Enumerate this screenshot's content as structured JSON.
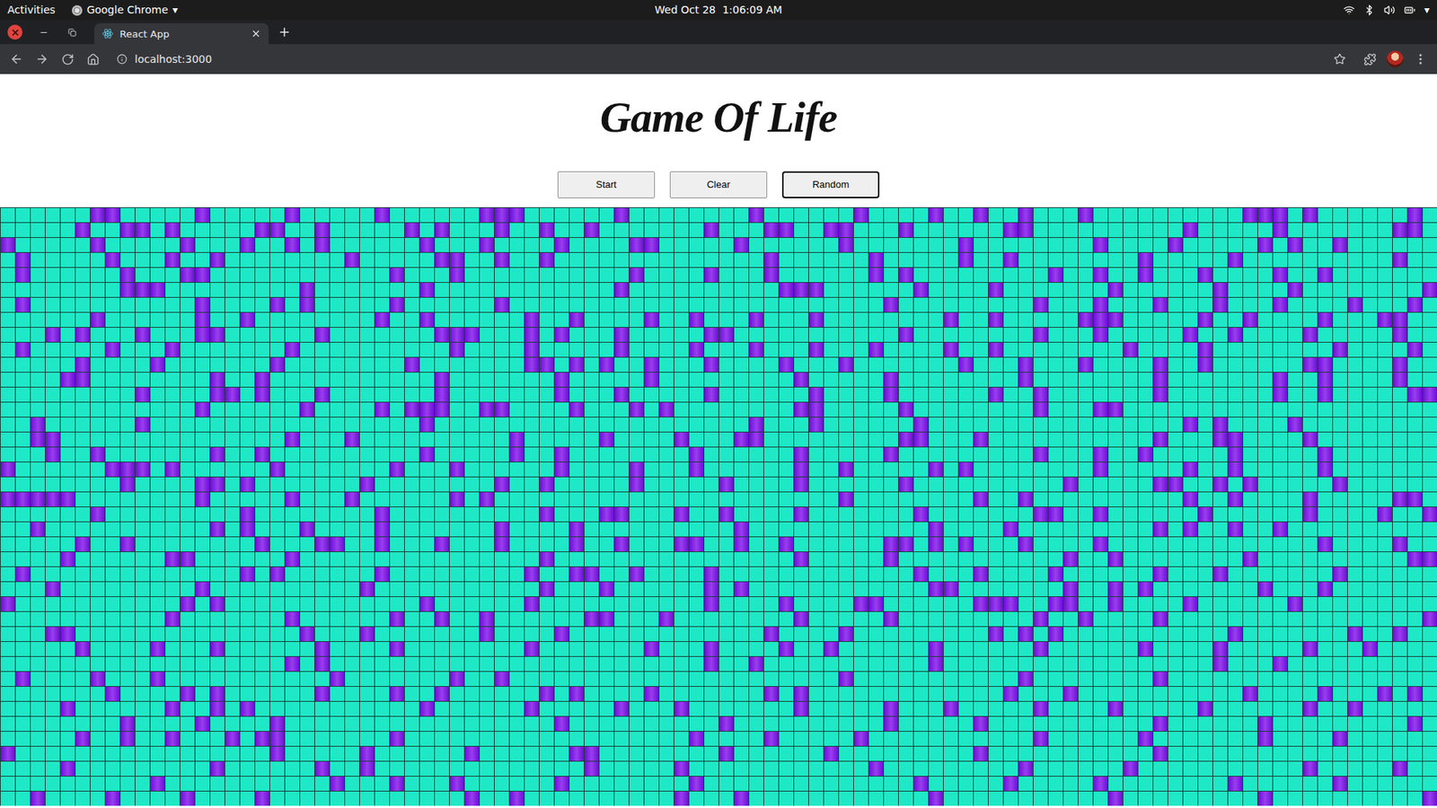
{
  "system_bar": {
    "activities": "Activities",
    "app_name": "Google Chrome",
    "app_menu_arrow": "▾",
    "clock": "Wed Oct 28  1:06:09 AM",
    "system_menu_arrow": "▾"
  },
  "browser": {
    "tabs": [
      {
        "title": "React App",
        "selected": true
      }
    ],
    "address": "localhost:3000"
  },
  "page": {
    "title": "Game Of Life",
    "buttons": [
      {
        "label": "Start",
        "focused": false
      },
      {
        "label": "Clear",
        "focused": false
      },
      {
        "label": "Random",
        "focused": true
      }
    ],
    "grid": {
      "rows": [
        "00000011 00000100 00010000 01000000 11100000 01000000 00100000 01000010 01001000 10000000 00011101 00000010",
        "00000100 11010000 01100100 00010100 01001001 00000001 00011001 10001000 00011000 00000001 00000100 00000110",
        "10000010 00001000 10010100 00001000 10000100 00110000 01000000 10000000 10000000 01000010 00001010 01000000",
        "01000001 00010010 00000001 00000110 01001000 00000000 00010000 00100000 10010000 00001000 00100000 00000100",
        "01000000 10001100 00000000 00100010 00000000 00100001 00010000 00101000 00000010 01001000 10000100 10000000",
        "00000000 11100000 00001000 00001000 00000000 01000000 00001110 00000100 00100000 00100000 01000010 00000001",
        "01000000 00000100 00101000 00100000 01000000 00000000 00000000 00010000 00000100 01000100 01000100 00100010",
        "00000010 00000100 10000000 01001000 00010010 00010010 00100010 00000001 00100000 11100000 10010000 10001100",
        "00010100 01000110 00000100 00000111 00010100 01000001 10000000 00001000 00000100 01000001 00100001 00000100",
        "01000001 00010000 00010000 00000010 00010000 01000010 00100010 00100001 00100000 00010000 10000000 01000010",
        "00000100 00100000 00100000 00010000 00011010 10010001 00001000 10000000 10001000 10000100 10000001 10000100",
        "00001100 00000010 01000000 00000100 00000100 00010000 00000100 00010000 00001000 00000100 00000100 10000100",
        "00000000 01000011 01000100 00000100 00000100 01000001 00000010 00010000 00100100 00000100 00000100 10000011",
        "00000000 00000100 00001000 01011100 11000010 00101000 00000110 00001000 00000100 01100000 00000000 00000000",
        "00100000 01000000 00000000 00001000 00000000 00000000 00100010 00000100 00000000 00000001 01000010 00000000",
        "00110000 00000000 00010001 00000000 00100000 10000100 01100000 00001100 01000000 00000100 01100001 00000000",
        "00010010 00000010 01000000 00001000 00100100 00000010 00000100 00010000 00000100 01001000 00100000 10000000",
        "10000001 11010000 00100000 00100010 00000100 00100010 00000100 10000010 10000000 01000001 00100000 10000000",
        "00000000 10000110 10000000 10000000 01001000 00100000 10000100 00001000 00000001 00000110 01010000 01000000",
        "11111000 00000100 00010001 00000010 10000000 00000000 00000000 10000000 01001000 00000001 00100001 00000110",
        "00000010 00000000 10000000 01000000 00001000 11000100 10000100 00000100 00000110 01000000 10000001 00001001",
        "00100000 00000010 10001000 01000000 01000010 00000000 01000000 00000010 00010000 00000101 00100100 00000000",
        "00000100 10000000 01000110 01000100 01000010 01000110 01001000 00011010 10001000 01000000 00000000 10000100",
        "00001000 00011000 00010000 00000000 00001000 00000000 00000100 00010000 00000001 00100000 00010000 00000011",
        "01000000 00000000 10100000 01000000 00010011 00100001 00000000 00000100 01000010 00000100 01000000 01000000",
        "00010000 00000100 00000000 10000000 00001000 10000001 01000000 00000011 00000001 00101000 00001000 10000000",
        "10000000 00001010 00000000 00001000 00010000 00000001 00001000 01100000 01110011 00100001 00000010 00000000",
        "00000000 00010000 00010000 00100100 10000001 10001000 00000100 00010000 00000100 10000100 00000000 00000001",
        "00011000 00000000 00001000 10000000 10000100 00000000 00010000 10000000 00101010 00000000 00100000 00100100",
        "00000100 00100010 00000100 00100000 00010000 00010001 00001001 00000010 00000100 00001000 01000001 00010000",
        "00000000 00000000 00010100 00000000 00000000 00000001 00100000 00000010 00000000 00000000 01000100 00000000",
        "01000010 00100000 00000010 00000010 01000000 00000000 00000000 10000000 00001000 00000100 00000000 00000000",
        "00000001 00001010 00000100 00100100 00001010 00010000 00010100 00000000 00010001 00000000 00010000 10001010",
        "00001000 00010010 10000000 00001000 00010000 01000100 00000100 00010001 00000100 00100000 10000001 00100000",
        "00000000 10000100 00100000 00000000 00000100 00000000 10000000 00010000 01000000 00000100 00001000 00000010",
        "00000100 10010001 01100000 00100000 00000000 00000010 00010000 01000000 00000100 00001000 00001000 01000000",
        "10000000 00000000 00100000 10000001 00000011 00000000 10000001 00000000 01000000 00000100 00000000 00000000",
        "00001000 00000010 00000100 10000000 00000001 00000100 00000000 00100000 00001000 00010000 00000001 00000100",
        "00000000 00100000 00000010 00100010 00000100 00000010 00000000 00000100 00010000 01000000 00100000 01000000",
        "00100001 00001000 01000000 00000001 00100000 00000100 01000000 00000010 00000000 00100000 00001000 00000001"
      ]
    }
  }
}
